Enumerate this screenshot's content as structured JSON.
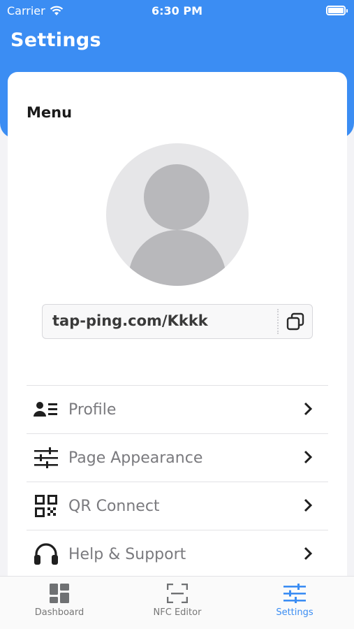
{
  "status_bar": {
    "carrier": "Carrier",
    "time": "6:30 PM"
  },
  "header": {
    "title": "Settings"
  },
  "card": {
    "menu_title": "Menu",
    "profile_url": "tap-ping.com/Kkkk",
    "items": [
      {
        "label": "Profile",
        "icon": "profile-card-icon"
      },
      {
        "label": "Page Appearance",
        "icon": "sliders-icon"
      },
      {
        "label": "QR Connect",
        "icon": "qr-code-icon"
      },
      {
        "label": "Help & Support",
        "icon": "headphones-icon"
      }
    ]
  },
  "tab_bar": {
    "tabs": [
      {
        "label": "Dashboard",
        "icon": "dashboard-icon"
      },
      {
        "label": "NFC Editor",
        "icon": "scan-frame-icon"
      },
      {
        "label": "Settings",
        "icon": "settings-sliders-icon",
        "active": true
      }
    ]
  },
  "colors": {
    "accent": "#3b8df3",
    "text_muted": "#7a7a7e",
    "icon_dark": "#1f1f1f",
    "tab_inactive": "#6f7173"
  }
}
